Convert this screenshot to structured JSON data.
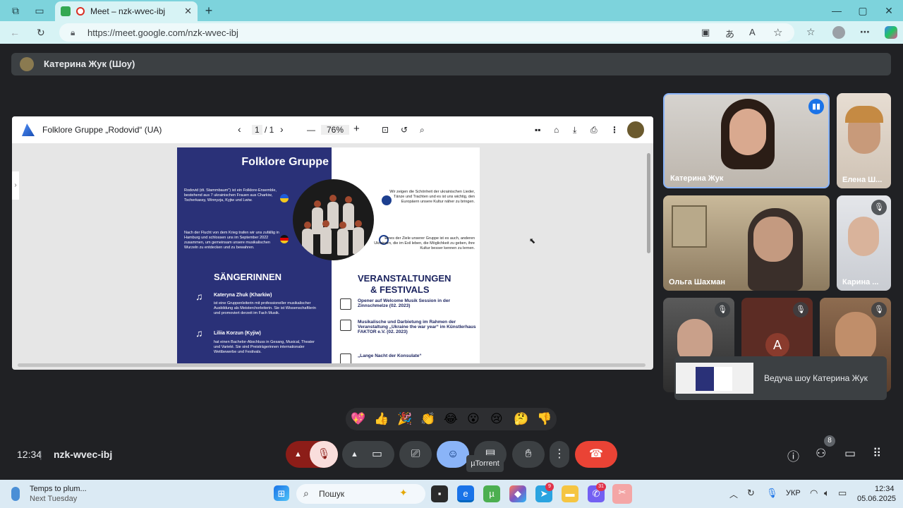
{
  "browser": {
    "tab_title": "Meet – nzk-wvec-ibj",
    "url": "https://meet.google.com/nzk-wvec-ibj"
  },
  "presenter": {
    "name": "Катерина Жук (Шоу)"
  },
  "pdf_viewer": {
    "file_title": "Folklore Gruppe „Rodovid“ (UA)",
    "page_current": "1",
    "page_total": "/ 1",
    "zoom": "76%"
  },
  "poster": {
    "title": "Folklore Gruppe „Rodovid“ (UA)",
    "intro": "Rodovid (dt. Stammbaum\") ist ein Folklore-Ensemble, bestehend aus 7 ukrainischen Frauen aus Charkiw, Tscherkassy, Winnyzja, Kyjiw und Lwiw.",
    "history": "Nach der Flucht von dem Krieg trafen wir uns zufällig in Hamburg und schlossen uns im September 2022 zusammen, um gemeinsam unsere musikalischen Wurzeln zu entdecken und zu bewahren.",
    "goal1": "Wir zeigen die Schönheit der ukrainischen Lieder, Tänze und Trachten und es ist uns wichtig, den Europäern unsere Kultur näher zu bringen.",
    "goal2": "Eines der Ziele unserer Gruppe ist es auch, anderen Ukrainern, die im Exil leben, die Möglichkeit zu geben, ihre Kultur besser kennen zu lernen.",
    "singers_heading": "SÄNGERINNEN",
    "singer1_name": "Kateryna Zhuk (Kharkiw)",
    "singer1_text": "ist eine Gruppenleiterin mit professioneller musikalischer Ausbildung als Meisterchorleiterin. Sie ist Wissenschaftlerin und promoviert derzeit im Fach Musik.",
    "singer2_name": "Liliia Korzun (Kyjiw)",
    "singer2_text": "hat einen Bachelor-Abschluss in Gesang, Musical, Theater und Varieté. Sie sind Preisträgerinnen internationaler Wettbewerbe und Festivals.",
    "events_heading1": "VERANSTALTUNGEN",
    "events_heading2": "& FESTIVALS",
    "event1": "Opener auf Welcome Musik Session in der Zinnschmelze (02. 2023)",
    "event2": "Musikalische und Darbietung im Rahmen der Veranstaltung „Ukraine the war year“ im Künstlerhaus FAKTOR e.V. (02. 2023)",
    "event3": "„Lange Nacht der Konsulate“"
  },
  "participants": [
    {
      "name": "Катерина Жук",
      "muted": false
    },
    {
      "name": "Елена Ш...",
      "muted": false
    },
    {
      "name": "Ольга Шахман",
      "muted": false
    },
    {
      "name": "Карина ...",
      "muted": true
    },
    {
      "name": "",
      "muted": true
    },
    {
      "name": "A",
      "muted": true
    },
    {
      "name": "",
      "muted": true
    }
  ],
  "presenting_card": {
    "label": "Ведуча шоу Катерина Жук"
  },
  "reactions": [
    "💖",
    "👍",
    "🎉",
    "👏",
    "😂",
    "😮",
    "😢",
    "🤔",
    "👎"
  ],
  "meeting": {
    "time": "12:34",
    "code": "nzk-wvec-ibj",
    "people_count": "8"
  },
  "tooltip": "µTorrent",
  "taskbar": {
    "weather_title": "Temps to plum...",
    "weather_sub": "Next Tuesday",
    "search_placeholder": "Пошук",
    "telegram_badge": "9",
    "viber_badge": "31",
    "lang": "УКР",
    "time": "12:34",
    "date": "05.06.2025"
  },
  "colors": {
    "accent": "#8ab4f8",
    "end_call": "#ea4335",
    "mic_muted": "#f9dedc"
  }
}
